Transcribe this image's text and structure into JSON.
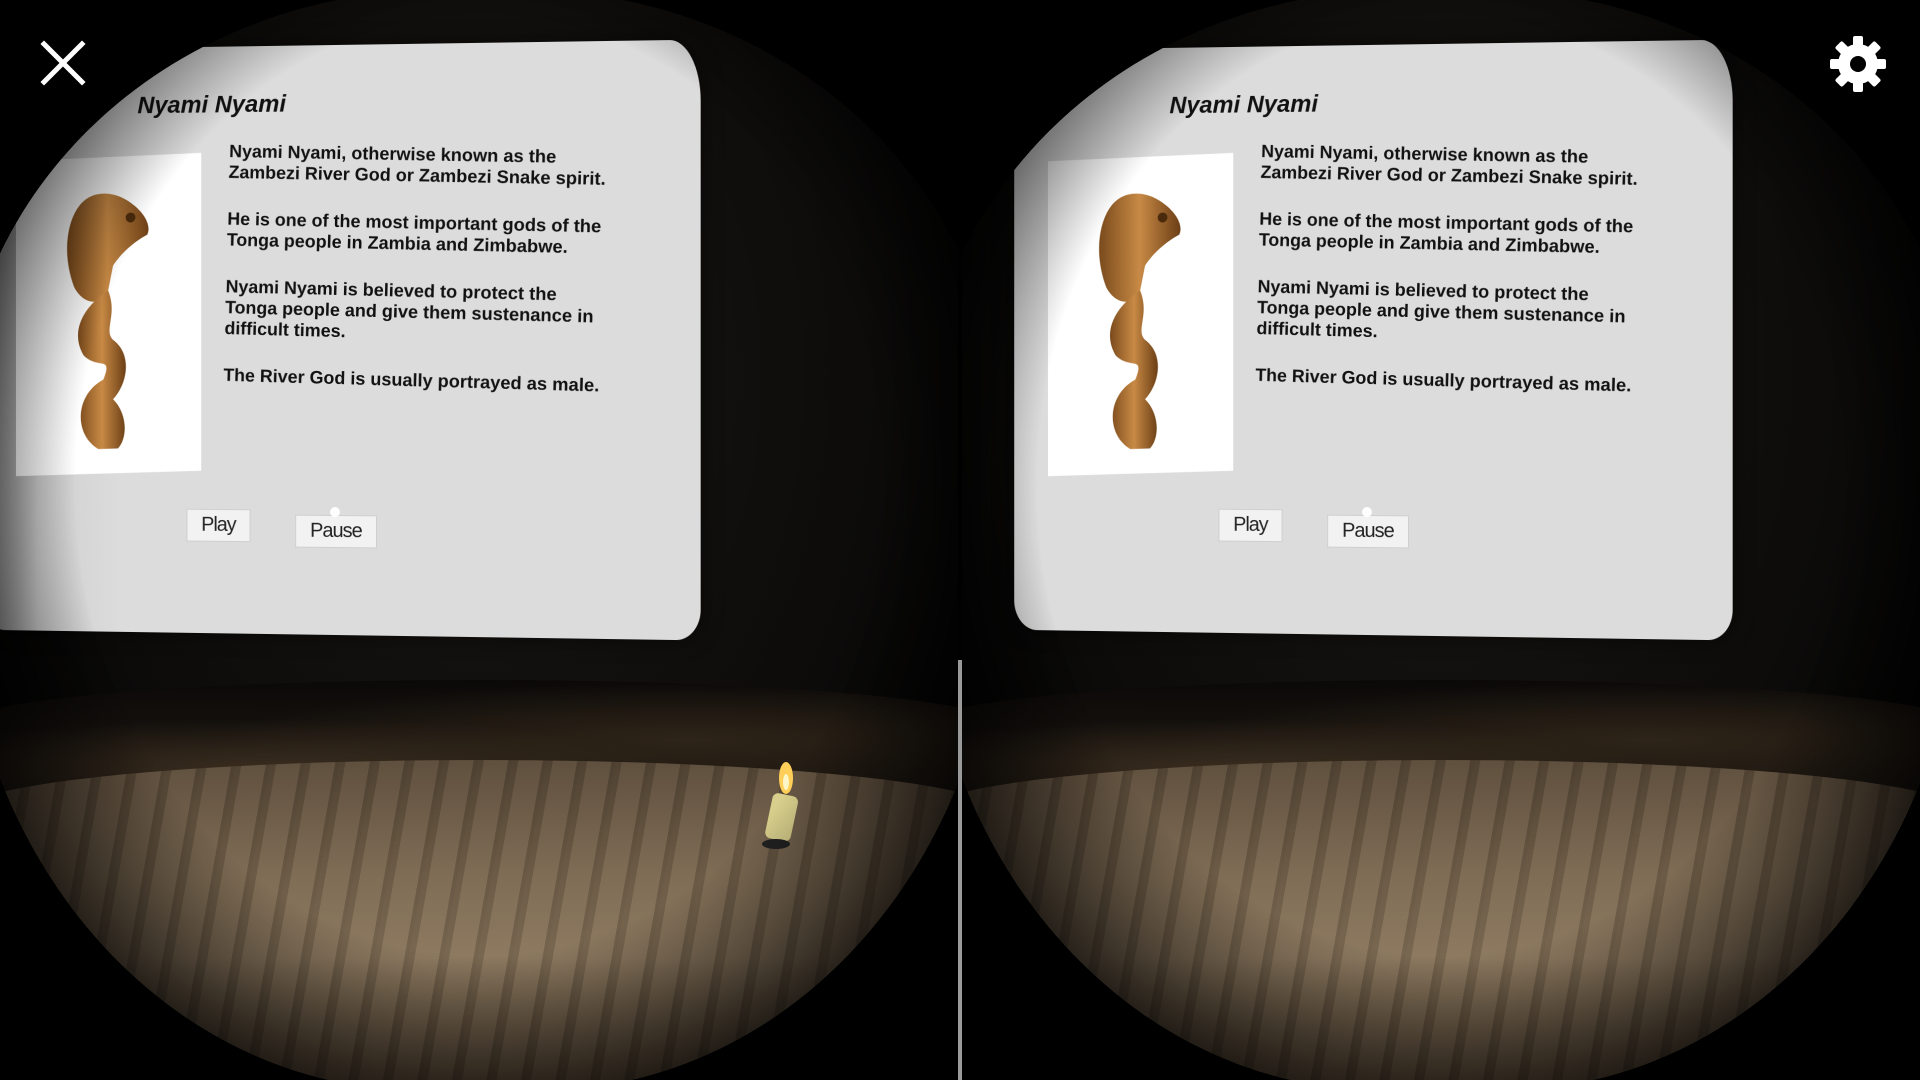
{
  "controls": {
    "close_icon": "close-icon",
    "settings_icon": "gear-icon"
  },
  "panel": {
    "title": "Nyami Nyami",
    "paragraphs": [
      "Nyami Nyami, otherwise known as the Zambezi River God or Zambezi Snake spirit.",
      "He is one of the most important gods of the Tonga people in Zambia and Zimbabwe.",
      "Nyami Nyami is believed to protect the Tonga people and give them sustenance in difficult times.",
      "The River God is usually portrayed as male."
    ],
    "play_label": "Play",
    "pause_label": "Pause",
    "image_subject": "carved wooden Nyami Nyami serpent figure"
  },
  "colors": {
    "panel": "#dcdcdc",
    "button": "#f2f2f2",
    "wood": "#7b6850"
  }
}
